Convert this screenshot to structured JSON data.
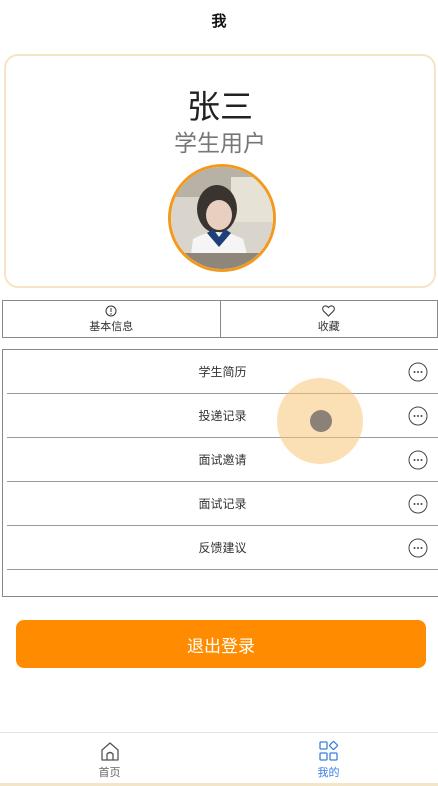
{
  "header": {
    "title": "我"
  },
  "profile": {
    "name": "张三",
    "role": "学生用户"
  },
  "info_tabs": [
    {
      "label": "基本信息",
      "icon": "info-icon"
    },
    {
      "label": "收藏",
      "icon": "heart-icon"
    }
  ],
  "menu": {
    "items": [
      {
        "label": "学生简历",
        "icon": "more-icon"
      },
      {
        "label": "投递记录",
        "icon": "more-icon"
      },
      {
        "label": "面试邀请",
        "icon": "more-icon"
      },
      {
        "label": "面试记录",
        "icon": "more-icon"
      },
      {
        "label": "反馈建议",
        "icon": "more-icon"
      }
    ]
  },
  "logout": {
    "label": "退出登录"
  },
  "tabbar": {
    "items": [
      {
        "label": "首页",
        "icon": "home-icon",
        "active": false
      },
      {
        "label": "我的",
        "icon": "grid-icon",
        "active": true
      }
    ]
  },
  "colors": {
    "accent": "#ff8c00",
    "avatar_border": "#f39a1e",
    "active_tab": "#3b7fe0",
    "card_border": "#f7e4c6"
  }
}
